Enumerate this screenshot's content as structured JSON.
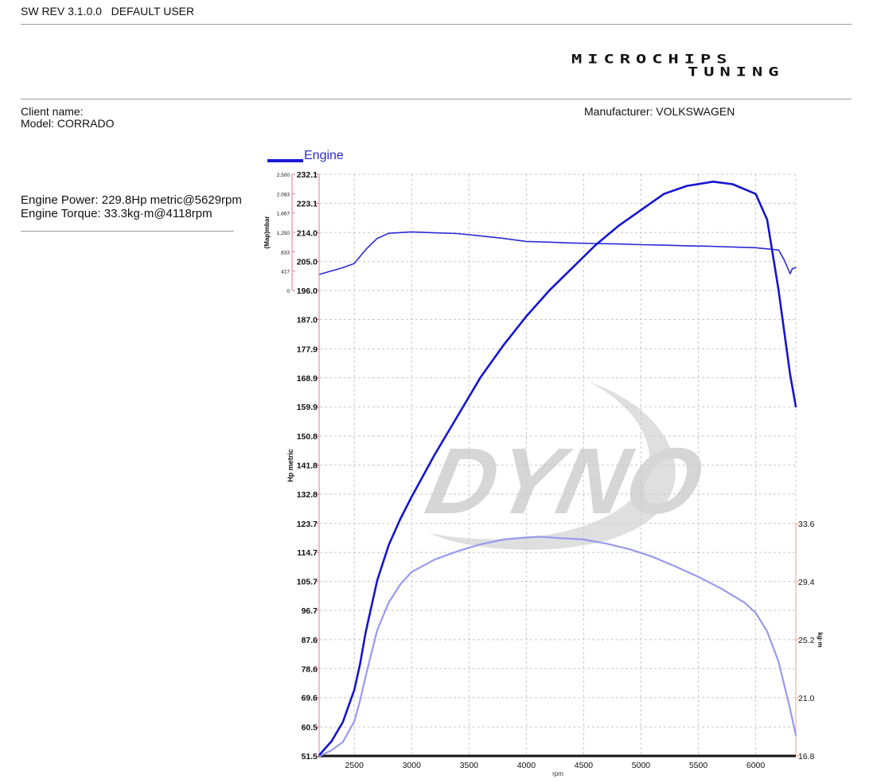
{
  "header": {
    "sw_rev": "SW REV 3.1.0.0",
    "user": "DEFAULT USER"
  },
  "logo": {
    "line1": "MICROCHIPS",
    "line2": "TUNING"
  },
  "vehicle": {
    "client_label": "Client name:",
    "client_value": "",
    "model_label": "Model:",
    "model_value": "CORRADO",
    "manufacturer_label": "Manufacturer:",
    "manufacturer_value": "VOLKSWAGEN"
  },
  "summary": {
    "power": "Engine Power: 229.8Hp metric@5629rpm",
    "torque": "Engine Torque: 33.3kg·m@4118rpm"
  },
  "watermark": "DYNO",
  "colors": {
    "power": "#1414d2",
    "boost": "#2a2ad8",
    "torque": "#9999ee",
    "left_axis": "#e07a9a",
    "right_axis": "#f0a080"
  },
  "chart_data": {
    "type": "line",
    "legend": [
      "Engine"
    ],
    "x": {
      "label": "rpm",
      "range": [
        2200,
        6350
      ],
      "ticks": [
        2500,
        3000,
        3500,
        4000,
        4500,
        5000,
        5500,
        6000
      ],
      "tick_labels": [
        "2500",
        "3000",
        "3500",
        "4000",
        "4500",
        "5000",
        "5500",
        "6000"
      ]
    },
    "y_power": {
      "label": "Hp metric",
      "range": [
        51.5,
        232.1
      ],
      "ticks": [
        51.5,
        60.5,
        69.6,
        78.6,
        87.6,
        96.7,
        105.7,
        114.7,
        123.7,
        132.8,
        141.8,
        150.8,
        159.9,
        168.9,
        177.9,
        187.0,
        196.0,
        205.0,
        214.0,
        223.1,
        232.1
      ],
      "tick_labels": [
        "51.5",
        "60.5",
        "69.6",
        "78.6",
        "87.6",
        "96.7",
        "105.7",
        "114.7",
        "123.7",
        "132.8",
        "141.8",
        "150.8",
        "159.9",
        "168.9",
        "177.9",
        "187.0",
        "196.0",
        "205.0",
        "214.0",
        "223.1",
        "232.1"
      ]
    },
    "y_boost": {
      "label": "(Map)mbar",
      "range": [
        0,
        2500
      ],
      "ticks": [
        0,
        417,
        833,
        1250,
        1667,
        2083,
        2500
      ],
      "tick_labels": [
        "0",
        "417",
        "833",
        "1.250",
        "1.667",
        "2.083",
        "2.500"
      ]
    },
    "y_torque": {
      "label": "kg·m",
      "range": [
        16.8,
        33.6
      ],
      "ticks": [
        16.8,
        21.0,
        25.2,
        29.4,
        33.6
      ],
      "tick_labels": [
        "16.8",
        "21.0",
        "25.2",
        "29.4",
        "33.6"
      ]
    },
    "grid": true,
    "series": [
      {
        "name": "Engine",
        "kind": "power",
        "x": [
          2200,
          2300,
          2400,
          2500,
          2550,
          2600,
          2700,
          2800,
          2900,
          3000,
          3200,
          3400,
          3600,
          3800,
          4000,
          4200,
          4400,
          4600,
          4800,
          5000,
          5200,
          5400,
          5629,
          5800,
          6000,
          6100,
          6200,
          6300,
          6350
        ],
        "y": [
          52,
          56,
          62,
          72,
          80,
          90,
          106,
          117,
          125,
          132,
          145,
          157,
          169,
          179,
          188,
          196,
          203,
          210,
          216,
          221,
          226,
          228.5,
          229.8,
          229,
          226,
          218,
          196,
          170,
          160
        ]
      },
      {
        "kind": "torque",
        "x": [
          2200,
          2300,
          2400,
          2500,
          2550,
          2600,
          2700,
          2800,
          2900,
          3000,
          3200,
          3400,
          3600,
          3800,
          4000,
          4118,
          4300,
          4500,
          4700,
          4900,
          5100,
          5300,
          5500,
          5700,
          5900,
          6000,
          6100,
          6200,
          6300,
          6350
        ],
        "y": [
          16.8,
          17.2,
          17.8,
          19.3,
          20.8,
          22.6,
          25.9,
          27.9,
          29.2,
          30.1,
          31.0,
          31.6,
          32.1,
          32.45,
          32.6,
          32.65,
          32.55,
          32.45,
          32.15,
          31.75,
          31.2,
          30.5,
          29.75,
          28.9,
          27.9,
          27.15,
          25.8,
          23.6,
          20.2,
          18.3
        ]
      },
      {
        "kind": "boost",
        "x": [
          2200,
          2400,
          2500,
          2600,
          2700,
          2800,
          3000,
          3200,
          3400,
          3600,
          3800,
          4000,
          4200,
          4400,
          4600,
          4800,
          5000,
          5200,
          5400,
          5600,
          5800,
          6000,
          6200,
          6250,
          6300,
          6320,
          6350
        ],
        "y": [
          350,
          490,
          580,
          880,
          1120,
          1230,
          1260,
          1240,
          1225,
          1175,
          1120,
          1055,
          1040,
          1020,
          1010,
          1000,
          985,
          975,
          960,
          950,
          935,
          920,
          870,
          650,
          360,
          470,
          490
        ]
      }
    ]
  }
}
